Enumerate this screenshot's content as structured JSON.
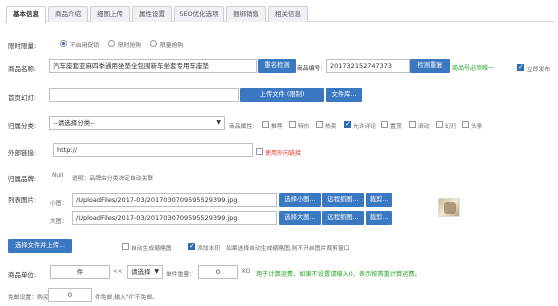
{
  "tabs": [
    "基本信息",
    "商品介绍",
    "细图上传",
    "属性设置",
    "SEO优化选项",
    "捆绑销售",
    "相关信息"
  ],
  "limit": {
    "label": "限时限量:",
    "options": [
      "不启用促销",
      "限时抢购",
      "限量抢购"
    ]
  },
  "product_name": {
    "label": "商品名称:",
    "value": "汽车座套亚麻四季通用坐垫全包围新车坐套专用车座垫",
    "check_btn": "重名检测",
    "code_label": "商品编号:",
    "code_value": "201732152747373",
    "code_btn": "检测重复",
    "code_note": "商品号必须唯一",
    "publish_label": "立即发布"
  },
  "banner": {
    "label": "首页幻灯:",
    "upload_btn": "上传文件 (限制)",
    "file_btn": "文件库..."
  },
  "category": {
    "label": "归属分类:",
    "placeholder": "--请选择分类--",
    "attr_label": "商品属性:",
    "attrs": [
      {
        "name": "推荐",
        "checked": false
      },
      {
        "name": "特价",
        "checked": false
      },
      {
        "name": "热卖",
        "checked": false
      },
      {
        "name": "允许评论",
        "checked": true
      },
      {
        "name": "置顶",
        "checked": false
      },
      {
        "name": "滚动",
        "checked": false
      },
      {
        "name": "幻灯",
        "checked": false
      },
      {
        "name": "头条",
        "checked": false
      }
    ]
  },
  "external": {
    "label": "外部链接:",
    "value": "http://",
    "note": "使用外向链接"
  },
  "brand": {
    "label": "归属品牌:",
    "value": "Null",
    "note": "说明：品牌由分类决定自动关联"
  },
  "images": {
    "label": "列表图片:",
    "small_label": "小图：",
    "small_value": "/UploadFiles/2017-03/2017030709595529399.jpg",
    "big_label": "大图：",
    "big_value": "/UploadFiles/2017-03/2017030709595529399.jpg",
    "small_btns": [
      "选择小图...",
      "远程抓图...",
      "裁剪..."
    ],
    "big_btns": [
      "选择大图...",
      "远程抓图...",
      "裁剪..."
    ]
  },
  "upload_row": {
    "btn": "选择文件并上传...",
    "auto_thumb": "自动生成缩略图",
    "watermark": "添加水印",
    "note": "如果选择自动生成缩略图,则不开启图片裁剪窗口"
  },
  "unit": {
    "label": "商品单位:",
    "unit_value": "件",
    "select_value": "请选择",
    "weight_label": "单件重量：",
    "weight_value": "0",
    "weight_unit": "KG",
    "note": "用于计算运费，如果不设置请输入0，表示按首重计算运费。"
  },
  "free": {
    "label": "免邮设置：购买",
    "value": "0",
    "note": "件免邮,输入\"0\"不免邮。"
  }
}
